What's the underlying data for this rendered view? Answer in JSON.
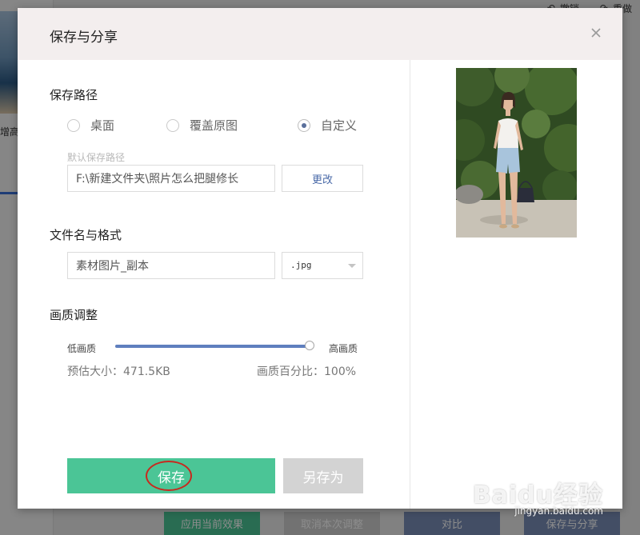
{
  "background": {
    "sidebar_thumb_label": "增高",
    "top_actions": [
      "撤销",
      "重做"
    ],
    "bottom_buttons": [
      {
        "label": "应用当前效果",
        "color": "#4bc596"
      },
      {
        "label": "取消本次调整",
        "color": "#cfcfcf"
      },
      {
        "label": "对比",
        "color": "#7a8fb8"
      },
      {
        "label": "保存与分享",
        "color": "#7a8fb8"
      }
    ]
  },
  "dialog": {
    "title": "保存与分享",
    "close_icon": "close-icon",
    "save_path": {
      "title": "保存路径",
      "options": [
        {
          "label": "桌面",
          "checked": false
        },
        {
          "label": "覆盖原图",
          "checked": false
        },
        {
          "label": "自定义",
          "checked": true
        }
      ],
      "default_label": "默认保存路径",
      "path_value": "F:\\新建文件夹\\照片怎么把腿修长",
      "change_button": "更改"
    },
    "file_format": {
      "title": "文件名与格式",
      "filename_value": "素材图片_副本",
      "format_value": ".jpg"
    },
    "quality": {
      "title": "画质调整",
      "low_label": "低画质",
      "high_label": "高画质",
      "level": 1.0,
      "estimated_size": "预估大小：471.5KB",
      "percent": "画质百分比：100%"
    },
    "buttons": {
      "save": "保存",
      "save_as": "另存为"
    },
    "colors": {
      "primary": "#4bc596",
      "slider": "#5f7fbe",
      "highlight_ring": "#c8291e"
    }
  },
  "watermark": {
    "brand": "Baidu经验",
    "url": "jingyan.baidu.com"
  }
}
